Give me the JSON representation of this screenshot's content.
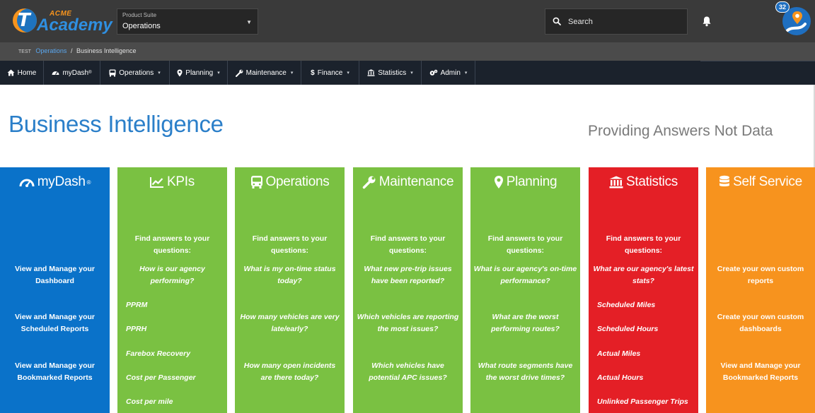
{
  "brand": {
    "acme": "ACME",
    "name": "Academy",
    "mark": "T"
  },
  "product_suite": {
    "label": "Product Suite",
    "value": "Operations"
  },
  "search": {
    "placeholder": "Search"
  },
  "notifications": {
    "count": "32"
  },
  "breadcrumb": {
    "env": "TEST",
    "parent": "Operations",
    "separator": "/",
    "current": "Business Intelligence"
  },
  "nav": {
    "home": "Home",
    "mydash": "myDash",
    "operations": "Operations",
    "planning": "Planning",
    "maintenance": "Maintenance",
    "finance": "Finance",
    "statistics": "Statistics",
    "admin": "Admin",
    "registered": "®",
    "dropdown_glyph": "▾"
  },
  "page": {
    "title": "Business Intelligence",
    "tagline": "Providing Answers Not Data"
  },
  "tiles": {
    "mydash": {
      "title": "myDash",
      "reg": "®",
      "color": "#0a72c9",
      "links": [
        "View and Manage your Dashboard",
        "View and Manage your Scheduled Reports",
        "View and Manage your Bookmarked Reports"
      ]
    },
    "kpis": {
      "title": "KPIs",
      "color": "#7ac142",
      "intro": "Find answers to your questions:",
      "question": "How is our agency performing?",
      "items": [
        "PPRM",
        "PPRH",
        "Farebox Recovery",
        "Cost per Passenger",
        "Cost per mile"
      ]
    },
    "operations": {
      "title": "Operations",
      "color": "#7ac142",
      "intro": "Find answers to your questions:",
      "questions": [
        "What is my on-time status today?",
        "How many vehicles are very late/early?",
        "How many open incidents are there today?"
      ]
    },
    "maintenance": {
      "title": "Maintenance",
      "color": "#7ac142",
      "intro": "Find answers to your questions:",
      "questions": [
        "What new pre-trip issues have been reported?",
        "Which vehicles are reporting the most issues?",
        "Which vehicles have potential APC issues?"
      ]
    },
    "planning": {
      "title": "Planning",
      "color": "#7ac142",
      "intro": "Find answers to your questions:",
      "questions": [
        "What is our agency's on-time performance?",
        "What are the worst performing routes?",
        "What route segments have the worst drive times?"
      ]
    },
    "statistics": {
      "title": "Statistics",
      "color": "#e41f26",
      "intro": "Find answers to your questions:",
      "question": "What are our agency's latest stats?",
      "items": [
        "Scheduled Miles",
        "Scheduled Hours",
        "Actual Miles",
        "Actual Hours",
        "Unlinked Passenger Trips"
      ]
    },
    "self_service": {
      "title": "Self Service",
      "color": "#f7931e",
      "links": [
        "Create your own custom reports",
        "Create your own custom dashboards",
        "View and Manage your Bookmarked Reports"
      ]
    }
  }
}
